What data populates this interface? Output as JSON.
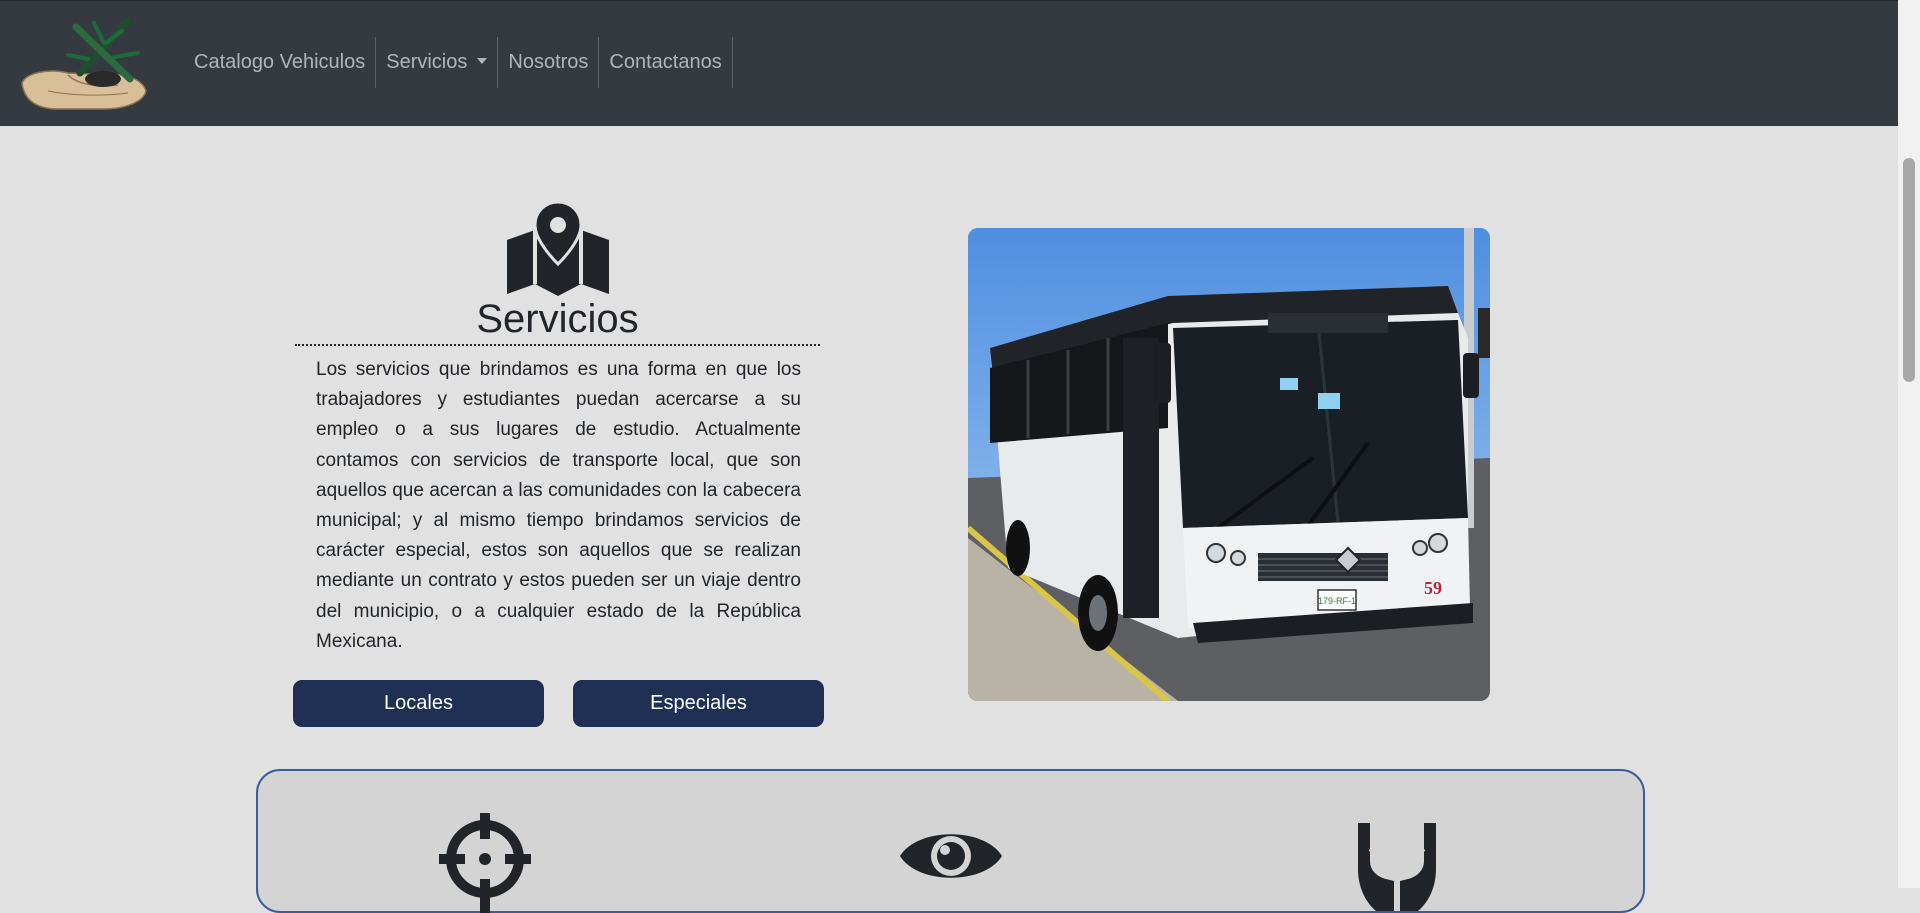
{
  "navbar": {
    "items": [
      {
        "label": "Catalogo Vehiculos"
      },
      {
        "label": "Servicios"
      },
      {
        "label": "Nosotros"
      },
      {
        "label": "Contactanos"
      }
    ]
  },
  "services": {
    "icon": "map-pin-icon",
    "title": "Servicios",
    "description": "Los servicios que brindamos es una forma en que los trabajadores y estudiantes puedan acercarse a su empleo o a sus lugares de estudio. Actualmente contamos con servicios de transporte local, que son aquellos que acercan a las comunidades con la cabecera municipal; y al mismo tiempo brindamos servicios de carácter especial, estos son aquellos que se realizan mediante un contrato y estos pueden ser un viaje dentro del municipio, o a cualquier estado de la República Mexicana.",
    "buttons": {
      "locales": "Locales",
      "especiales": "Especiales"
    }
  },
  "photo": {
    "bus_number": "59",
    "plate": "179-RF-1"
  },
  "panel": {
    "icons": [
      "crosshair-icon",
      "eye-icon",
      "hands-icon"
    ]
  },
  "colors": {
    "navbar_bg": "#343a40",
    "page_bg": "#e1e1e1",
    "button_bg": "#1f3054",
    "panel_border": "#3f5c9a"
  }
}
